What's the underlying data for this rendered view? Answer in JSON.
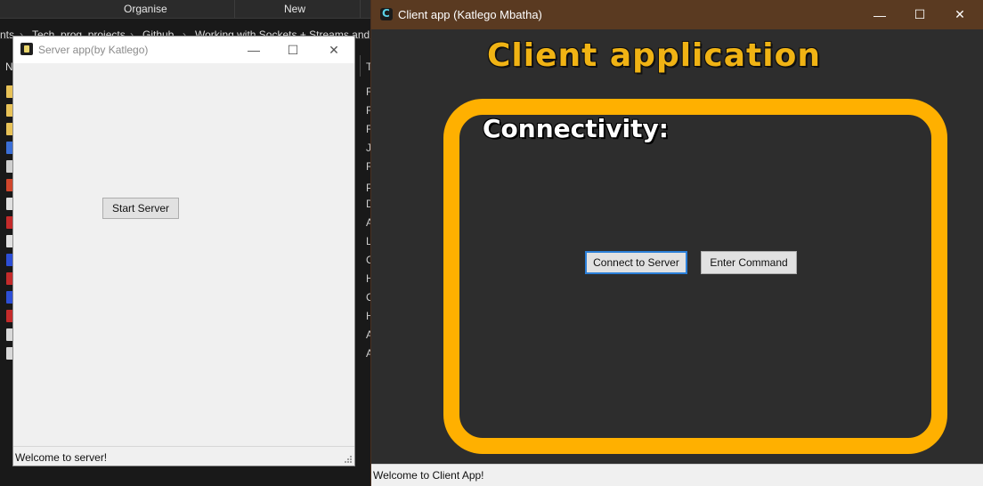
{
  "explorer": {
    "ribbon": {
      "organise": "Organise",
      "new": "New"
    },
    "breadcrumb": [
      "nts",
      "Tech_prog_projects",
      "Github",
      "Working with Sockets + Streams and S"
    ],
    "breadcrumb_sep": "›",
    "left_header": "N",
    "right_header": "T",
    "right_letters": [
      "F",
      "F",
      "F",
      "J",
      "R",
      "P",
      "D",
      "A",
      "L",
      "C",
      "H",
      "C",
      "H",
      "A",
      "A"
    ]
  },
  "server": {
    "title": "Server app(by Katlego)",
    "start_label": "Start Server",
    "status": "Welcome to server!",
    "minimize": "—",
    "maximize": "☐",
    "close": "✕"
  },
  "client": {
    "title": "Client app (Katlego Mbatha)",
    "heading": "Client application",
    "connectivity_label": "Connectivity:",
    "connect_label": "Connect to Server",
    "command_label": "Enter Command",
    "status": "Welcome to Client App!",
    "minimize": "—",
    "maximize": "☐",
    "close": "✕"
  },
  "colors": {
    "client_titlebar": "#5a3a21",
    "accent_orange": "#ffb000",
    "client_bg": "#2d2d2d",
    "server_bg": "#f0f0f0"
  }
}
